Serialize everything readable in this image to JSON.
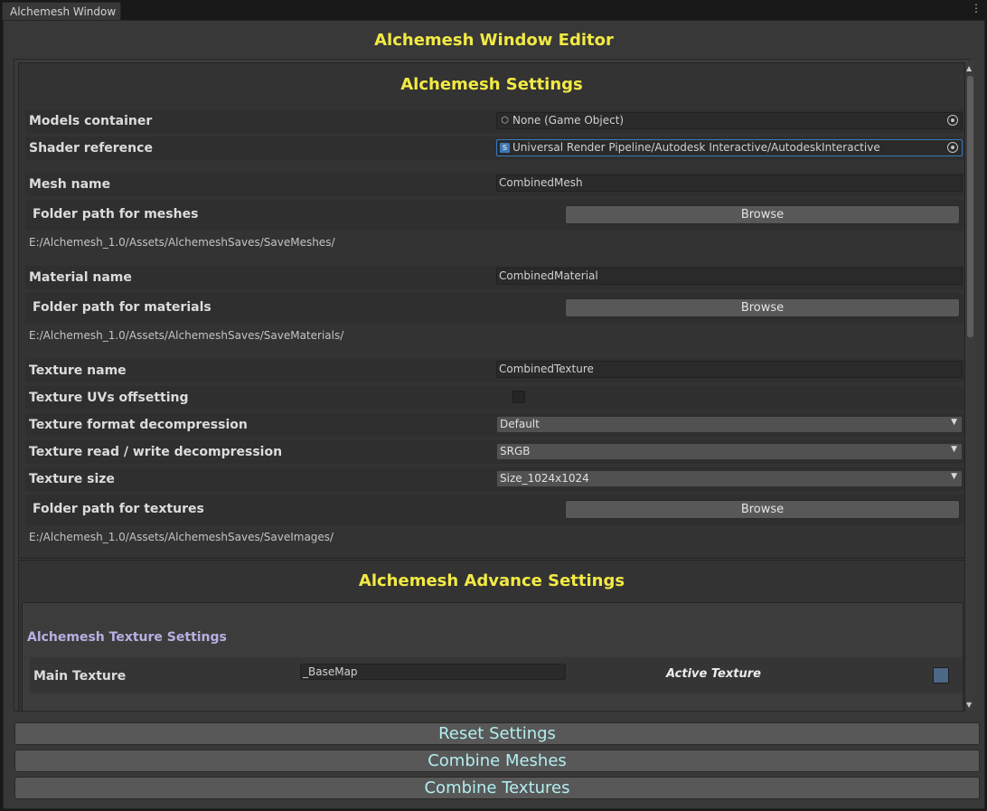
{
  "tab": {
    "title": "Alchemesh Window",
    "menu_glyph": "⋮"
  },
  "window_title": "Alchemesh Window Editor",
  "settings": {
    "title": "Alchemesh Settings",
    "models_container": {
      "label": "Models container",
      "value": "None (Game Object)",
      "icon": "cube-icon"
    },
    "shader_reference": {
      "label": "Shader reference",
      "value": "Universal Render Pipeline/Autodesk Interactive/AutodeskInteractive",
      "icon": "shader-icon"
    },
    "mesh_name": {
      "label": "Mesh name",
      "value": "CombinedMesh"
    },
    "folder_meshes": {
      "label": "Folder path for meshes",
      "button": "Browse",
      "path": "E:/Alchemesh_1.0/Assets/AlchemeshSaves/SaveMeshes/"
    },
    "material_name": {
      "label": "Material name",
      "value": "CombinedMaterial"
    },
    "folder_materials": {
      "label": "Folder path for materials",
      "button": "Browse",
      "path": "E:/Alchemesh_1.0/Assets/AlchemeshSaves/SaveMaterials/"
    },
    "texture_name": {
      "label": "Texture name",
      "value": "CombinedTexture"
    },
    "uv_offsetting": {
      "label": "Texture UVs offsetting",
      "checked": false
    },
    "format_decompression": {
      "label": "Texture format decompression",
      "value": "Default"
    },
    "rw_decompression": {
      "label": "Texture read / write decompression",
      "value": "SRGB"
    },
    "texture_size": {
      "label": "Texture size",
      "value": "Size_1024x1024"
    },
    "folder_textures": {
      "label": "Folder path for textures",
      "button": "Browse",
      "path": "E:/Alchemesh_1.0/Assets/AlchemeshSaves/SaveImages/"
    }
  },
  "advance": {
    "title": "Alchemesh Advance Settings",
    "texture_settings_title": "Alchemesh Texture Settings",
    "main_texture": {
      "label": "Main Texture",
      "value": "_BaseMap",
      "active_label": "Active Texture",
      "active": true
    }
  },
  "buttons": {
    "reset": "Reset Settings",
    "combine_meshes": "Combine Meshes",
    "combine_textures": "Combine Textures"
  },
  "colors": {
    "title_yellow": "#f2ea44",
    "button_text": "#b4eef0",
    "section_purple": "#b8b0e2",
    "selection_blue": "#3a79bb"
  }
}
